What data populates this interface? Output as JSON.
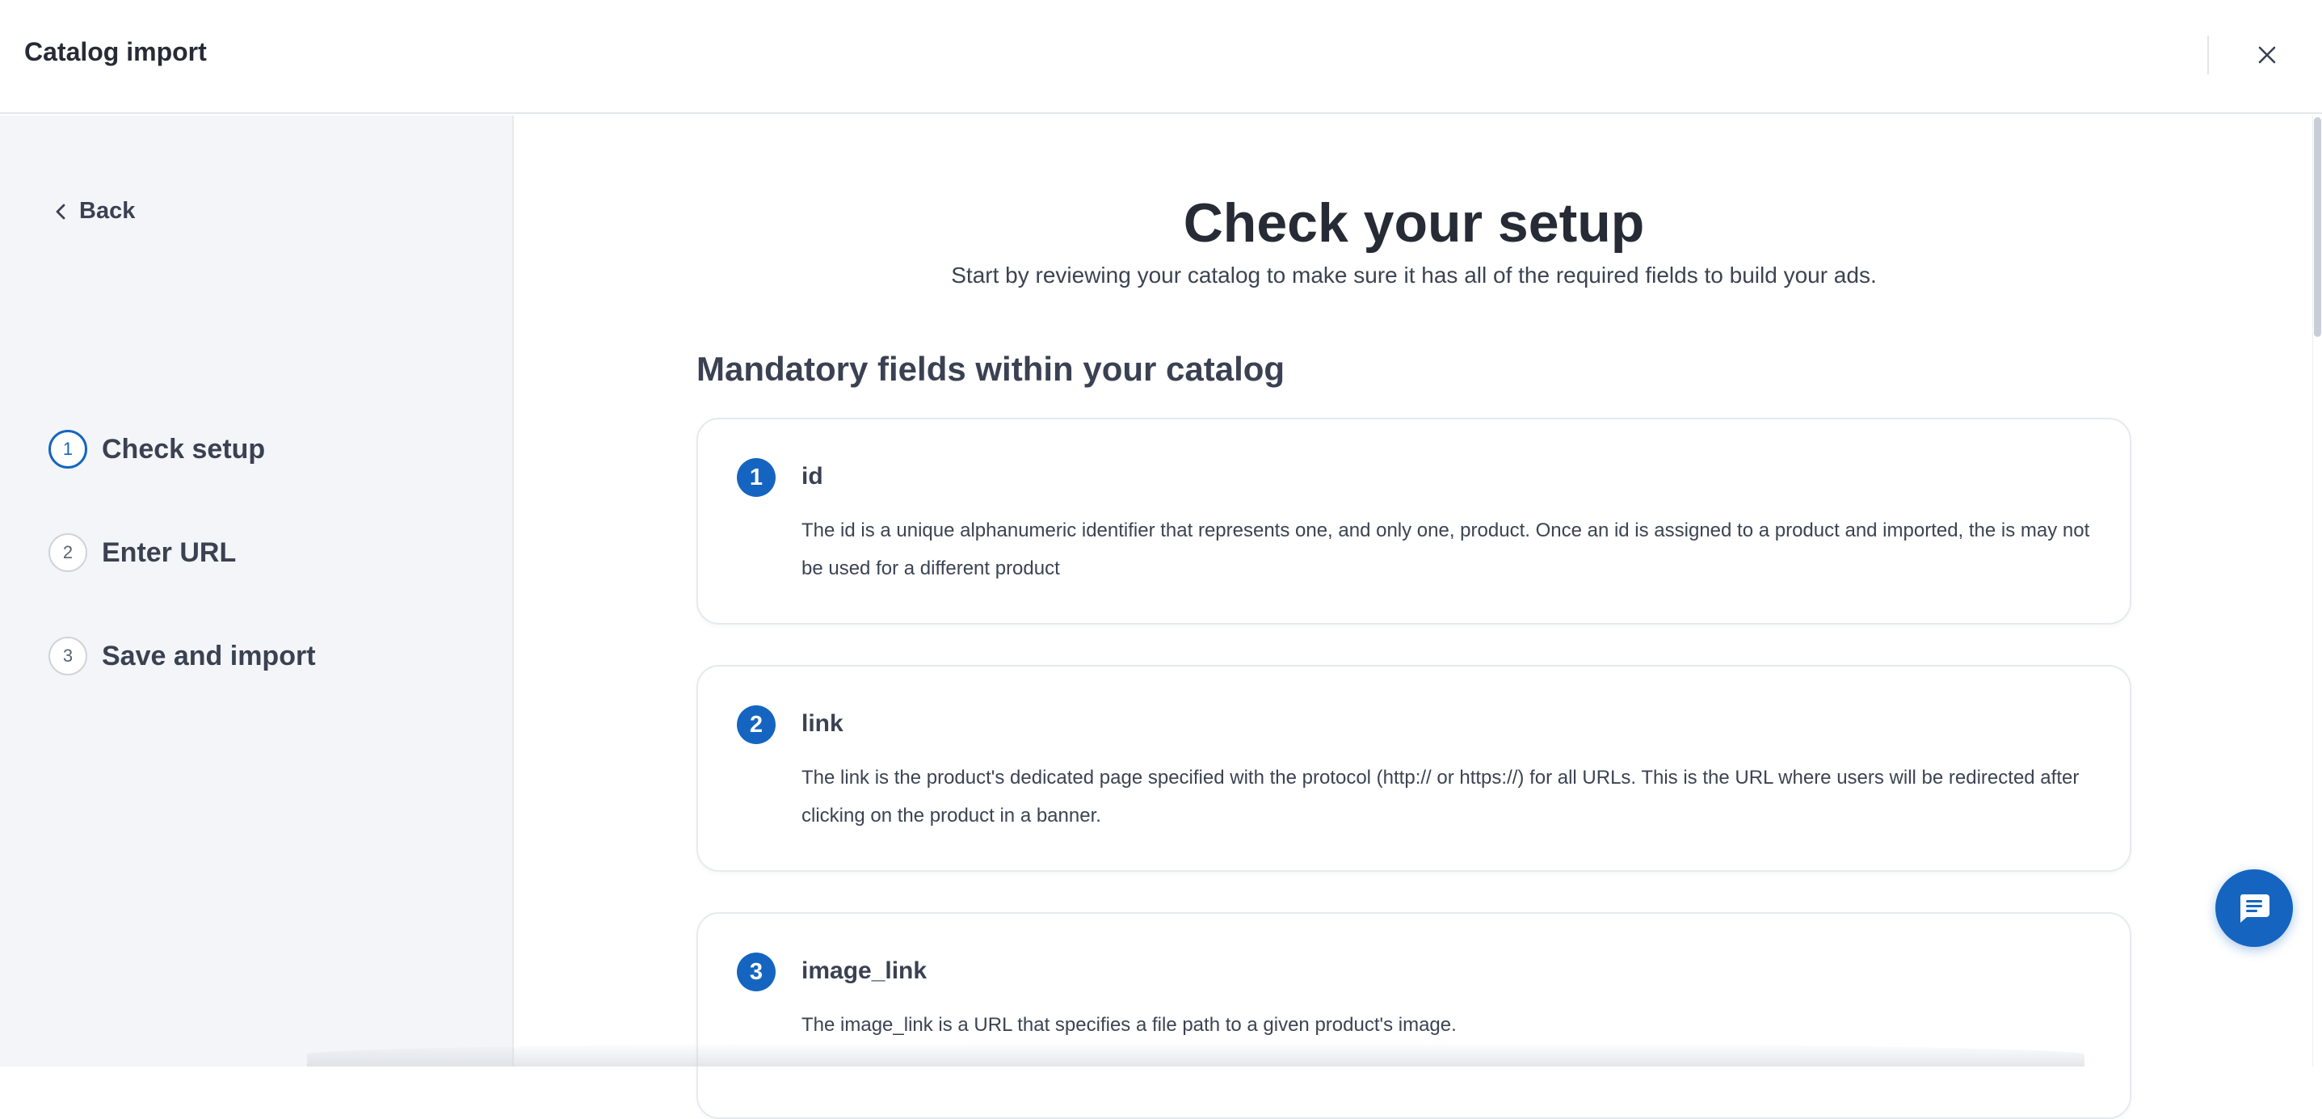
{
  "window": {
    "title": "Catalog import"
  },
  "sidebar": {
    "back_label": "Back",
    "steps": [
      {
        "number": "1",
        "label": "Check setup",
        "active": true
      },
      {
        "number": "2",
        "label": "Enter URL",
        "active": false
      },
      {
        "number": "3",
        "label": "Save and import",
        "active": false
      }
    ]
  },
  "main": {
    "heading": "Check your setup",
    "subheading": "Start by reviewing your catalog to make sure it has all of the required fields to build your ads.",
    "section_title": "Mandatory fields within your catalog",
    "fields": [
      {
        "number": "1",
        "name": "id",
        "description": "The id is a unique alphanumeric identifier that represents one, and only one, product. Once an id is assigned to a product and imported, the is may not be used for a different product"
      },
      {
        "number": "2",
        "name": "link",
        "description": "The link is the product's dedicated page specified with the protocol (http:// or https://) for all URLs. This is the URL where users will be redirected after clicking on the product in a banner."
      },
      {
        "number": "3",
        "name": "image_link",
        "description": "The image_link is a URL that specifies a file path to a given product's image."
      }
    ]
  },
  "icons": {
    "close": "close-icon",
    "back": "chevron-left-icon",
    "chat": "chat-icon"
  },
  "colors": {
    "accent": "#1565c0",
    "sidebar_bg": "#f3f5f8",
    "text": "#2a2f3a"
  }
}
